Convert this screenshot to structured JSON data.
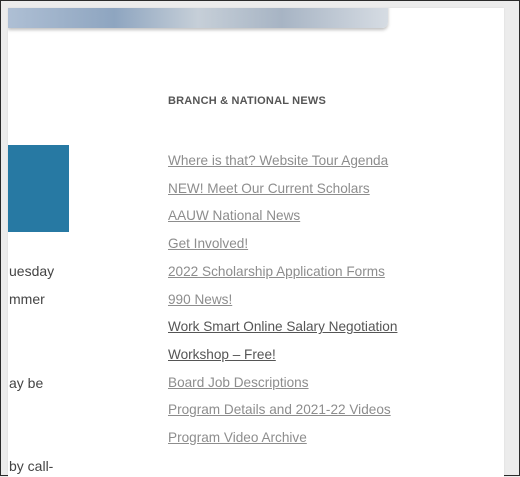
{
  "sidebar": {
    "heading": "BRANCH & NATIONAL NEWS",
    "links": [
      {
        "label": "Where is that? Website Tour Agenda",
        "emphasis": false
      },
      {
        "label": "NEW! Meet Our Current Scholars",
        "emphasis": false
      },
      {
        "label": "AAUW National News",
        "emphasis": false
      },
      {
        "label": "Get Involved!",
        "emphasis": false
      },
      {
        "label": "2022 Scholarship Application Forms",
        "emphasis": false
      },
      {
        "label": "990 News!",
        "emphasis": false
      },
      {
        "label": "Work Smart Online Salary Negotiation",
        "emphasis": true
      },
      {
        "label": "Workshop – Free!",
        "emphasis": true
      },
      {
        "label": "Board Job Descriptions",
        "emphasis": false
      },
      {
        "label": "Program Details and 2021-22 Videos",
        "emphasis": false
      },
      {
        "label": "Program Video Archive",
        "emphasis": false
      }
    ]
  },
  "main": {
    "fragments": [
      "uesday",
      "mmer",
      "ay be",
      "by call-"
    ]
  },
  "colors": {
    "callout": "#2779a3",
    "link": "#8d8d8d",
    "link_emphasis": "#555555"
  }
}
